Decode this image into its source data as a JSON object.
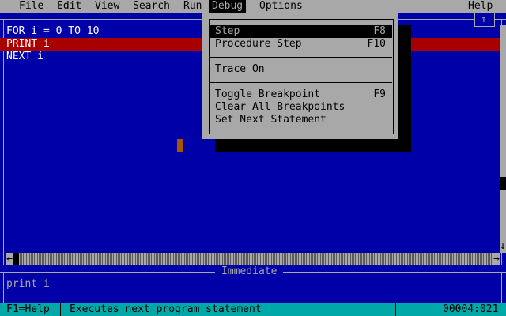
{
  "menubar": {
    "items": [
      "File",
      "Edit",
      "View",
      "Search",
      "Run",
      "Debug",
      "Options"
    ],
    "help": "Help"
  },
  "editor": {
    "lines": [
      "FOR i = 0 TO 10",
      "PRINT i",
      "NEXT i"
    ],
    "up_arrow": "↑",
    "down_arrow": "↓",
    "left_arrow": "←",
    "right_arrow": "→"
  },
  "debug_menu": {
    "items": [
      {
        "label": "Step",
        "key": "F8"
      },
      {
        "label": "Procedure Step",
        "key": "F10"
      },
      {
        "label": "Trace On",
        "key": ""
      },
      {
        "label": "Toggle Breakpoint",
        "key": "F9"
      },
      {
        "label": "Clear All Breakpoints",
        "key": ""
      },
      {
        "label": "Set Next Statement",
        "key": ""
      }
    ]
  },
  "immediate": {
    "title": "Immediate",
    "lines": [
      "print i"
    ]
  },
  "status": {
    "help": "F1=Help",
    "message": "Executes next program statement",
    "position": "00004:021"
  },
  "colors": {
    "background": "#0000a8",
    "highlight": "#a80000",
    "menu": "#a8a8a8",
    "status": "#00a8a8",
    "cursor": "#a85400"
  }
}
